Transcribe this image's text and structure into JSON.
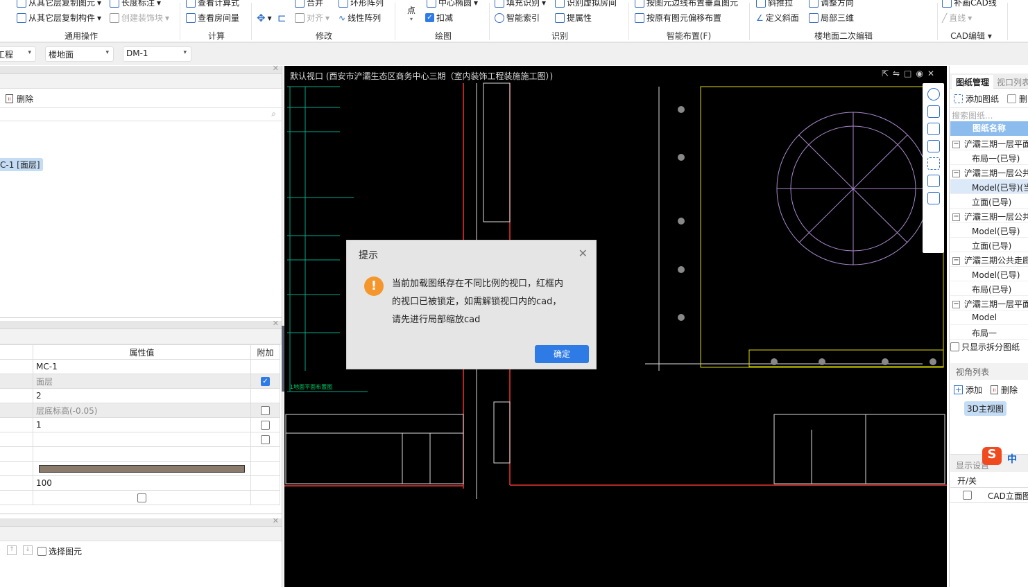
{
  "ribbon": {
    "row1": [
      "从其它层复制图元",
      "长度标注",
      "查看计算式",
      "合并",
      "环形阵列",
      "中心椭圆",
      "填充识别",
      "识别虚拟房间",
      "按图元边线布置垂直图元",
      "斜推拉",
      "调整方向",
      "补画CAD线"
    ],
    "row2": [
      "从其它层复制构件",
      "创建装饰块",
      "查看房间量",
      "对齐",
      "线性阵列",
      "点",
      "扣减",
      "智能索引",
      "提属性",
      "按原有图元偏移布置",
      "定义斜面",
      "局部三维",
      "直线"
    ],
    "groups": [
      "通用操作",
      "计算",
      "修改",
      "绘图",
      "识别",
      "智能布置(F)",
      "楼地面二次编辑",
      "CAD编辑"
    ],
    "kou_jian_checked": true
  },
  "toolbar": {
    "dropdowns": [
      "工程",
      "楼地面",
      "DM-1"
    ]
  },
  "left": {
    "delete_label": "删除",
    "selected_item": "C-1 [面层]",
    "props_header": {
      "value": "属性值",
      "extra": "附加"
    },
    "rows": [
      {
        "value": "MC-1",
        "extra": null
      },
      {
        "value": "面层",
        "extra": true,
        "gray": true
      },
      {
        "value": "2",
        "extra": null
      },
      {
        "value": "层底标高(-0.05)",
        "extra": false,
        "gray": true
      },
      {
        "value": "1",
        "extra": false
      },
      {
        "value": "",
        "extra": false
      },
      {
        "value": "",
        "extra": null
      },
      {
        "value": "",
        "color": "#8b7b6b"
      },
      {
        "value": "100",
        "extra": null
      },
      {
        "value": "",
        "checkbox": false
      }
    ],
    "select_element": "选择图元"
  },
  "canvas": {
    "title": "默认视口 (西安市浐灞生态区商务中心三期（室内装饰工程装施施工图）)",
    "caption": "1地面平面布置图"
  },
  "dialog": {
    "title": "提示",
    "lines": [
      "当前加载图纸存在不同比例的视口，红框内",
      "的视口已被锁定，如需解锁视口内的cad，",
      "请先进行局部缩放cad"
    ],
    "ok": "确定",
    "icon": "warning-icon",
    "accent": "#2f7be6"
  },
  "right": {
    "tabs": [
      "图纸管理",
      "视口列表"
    ],
    "add_sheet": "添加图纸",
    "delete_short": "删",
    "search_placeholder": "搜索图纸...",
    "header": "图纸名称",
    "tree": [
      {
        "label": "浐灞三期一层平面",
        "level": 0
      },
      {
        "label": "布局一(已导)",
        "level": 1
      },
      {
        "label": "浐灞三期一层公共",
        "level": 0
      },
      {
        "label": "Model(已导)(当",
        "level": 1,
        "selected": true
      },
      {
        "label": "立面(已导)",
        "level": 1
      },
      {
        "label": "浐灞三期一层公共",
        "level": 0
      },
      {
        "label": "Model(已导)",
        "level": 1
      },
      {
        "label": "立面(已导)",
        "level": 1
      },
      {
        "label": "浐灞三期公共走廊",
        "level": 0
      },
      {
        "label": "Model(已导)",
        "level": 1
      },
      {
        "label": "布局(已导)",
        "level": 1
      },
      {
        "label": "浐灞三期一层平面",
        "level": 0
      },
      {
        "label": "Model",
        "level": 1
      },
      {
        "label": "布局一",
        "level": 1
      }
    ],
    "only_split": "只显示拆分图纸",
    "view_list": "视角列表",
    "add": "添加",
    "delete": "删除",
    "view_chip": "3D主视图",
    "display_settings": "显示设置",
    "onoff": "开/关",
    "cad_elev": "CAD立面图",
    "ime": "中"
  }
}
